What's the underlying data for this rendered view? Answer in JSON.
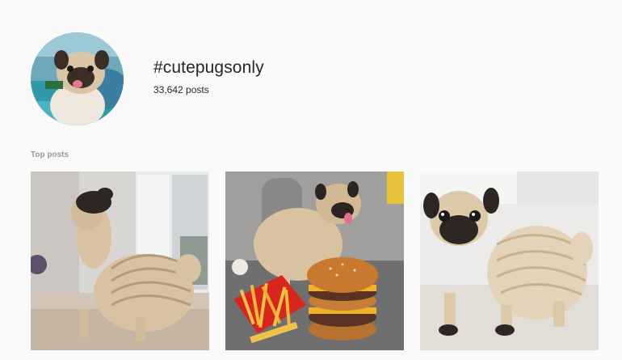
{
  "header": {
    "hashtag": "#cutepugsonly",
    "post_count": "33,642 posts"
  },
  "sections": {
    "top_posts_label": "Top posts"
  },
  "posts": [
    {
      "subject": "pug-by-window-photo"
    },
    {
      "subject": "pug-with-burger-and-fries-photo"
    },
    {
      "subject": "pug-standing-white-room-photo"
    }
  ]
}
